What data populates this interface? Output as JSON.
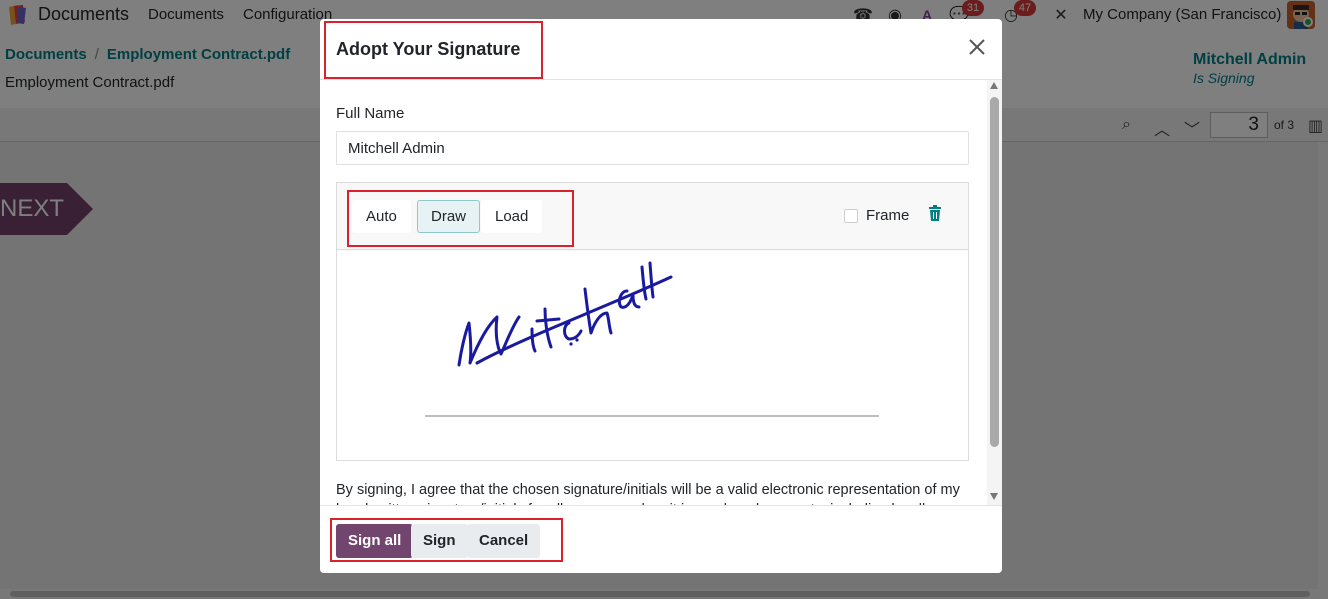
{
  "navbar": {
    "app_name": "Documents",
    "menu": [
      "Documents",
      "Configuration"
    ],
    "messages_badge": "31",
    "activity_badge": "47",
    "company": "My Company (San Francisco)"
  },
  "control_panel": {
    "breadcrumb": [
      "Documents",
      "Employment Contract.pdf"
    ],
    "record_name": "Employment Contract.pdf",
    "signer_name": "Mitchell Admin",
    "signer_status": "Is Signing"
  },
  "pdf_viewer": {
    "page": "3",
    "of_pages": "of 3",
    "next_label": "NEXT"
  },
  "modal": {
    "title": "Adopt Your Signature",
    "full_name_label": "Full Name",
    "full_name_value": "Mitchell Admin",
    "tabs": [
      "Auto",
      "Draw",
      "Load"
    ],
    "active_tab": "Draw",
    "frame_label": "Frame",
    "agreement": "By signing, I agree that the chosen signature/initials will be a valid electronic representation of my hand-written signature/initials for all purposes when it is used on documents, including legally binding contracts.",
    "footer": {
      "sign_all": "Sign all",
      "sign": "Sign",
      "cancel": "Cancel"
    }
  },
  "colors": {
    "primary": "#71456d",
    "teal": "#017e84",
    "highlight": "#d9222a",
    "ink": "#1a1aa0"
  }
}
